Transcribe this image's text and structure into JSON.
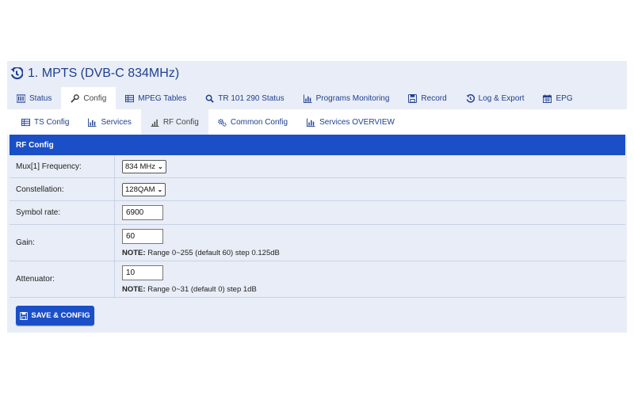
{
  "page": {
    "title": "1. MPTS (DVB-C 834MHz)"
  },
  "main_tabs": [
    {
      "label": "Status",
      "icon": "status-bars-icon"
    },
    {
      "label": "Config",
      "icon": "wrench-icon",
      "active": true
    },
    {
      "label": "MPEG Tables",
      "icon": "table-icon"
    },
    {
      "label": "TR 101 290 Status",
      "icon": "search-icon"
    },
    {
      "label": "Programs Monitoring",
      "icon": "bar-chart-icon"
    },
    {
      "label": "Record",
      "icon": "save-icon"
    },
    {
      "label": "Log & Export",
      "icon": "history-icon"
    },
    {
      "label": "EPG",
      "icon": "calendar-icon"
    }
  ],
  "sub_tabs": [
    {
      "label": "TS Config",
      "icon": "table-icon"
    },
    {
      "label": "Services",
      "icon": "bar-chart-icon"
    },
    {
      "label": "RF Config",
      "icon": "signal-icon",
      "active": true
    },
    {
      "label": "Common Config",
      "icon": "cogs-icon"
    },
    {
      "label": "Services OVERVIEW",
      "icon": "bar-chart-icon"
    }
  ],
  "rf": {
    "header": "RF Config",
    "mux_label": "Mux[1] Frequency:",
    "mux_value": "834 MHz",
    "const_label": "Constellation:",
    "const_value": "128QAM",
    "sr_label": "Symbol rate:",
    "sr_value": "6900",
    "gain_label": "Gain:",
    "gain_value": "60",
    "gain_note_label": "NOTE:",
    "gain_note": " Range 0~255 (default 60) step 0.125dB",
    "att_label": "Attenuator:",
    "att_value": "10",
    "att_note_label": "NOTE:",
    "att_note": " Range 0~31 (default 0) step 1dB"
  },
  "actions": {
    "save_label": "SAVE & CONFIG"
  },
  "colors": {
    "accent": "#1a4fc7",
    "title": "#1f3f8f",
    "panel": "#e8edf7"
  }
}
